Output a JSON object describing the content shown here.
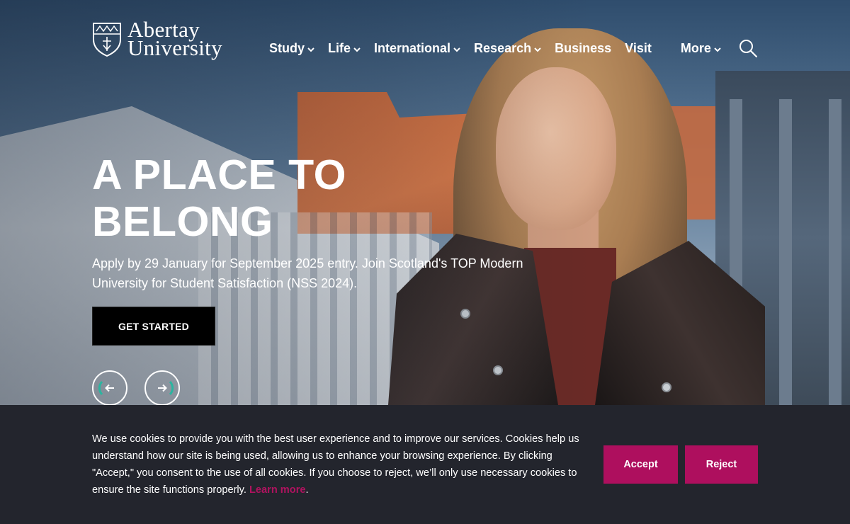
{
  "header": {
    "logo": {
      "line1": "Abertay",
      "line2": "University"
    },
    "nav": [
      {
        "label": "Study",
        "has_dropdown": true
      },
      {
        "label": "Life",
        "has_dropdown": true
      },
      {
        "label": "International",
        "has_dropdown": true
      },
      {
        "label": "Research",
        "has_dropdown": true
      },
      {
        "label": "Business",
        "has_dropdown": false
      },
      {
        "label": "Visit",
        "has_dropdown": false
      },
      {
        "label": "More",
        "has_dropdown": true
      }
    ],
    "search_icon": "search-icon"
  },
  "hero": {
    "title_line1": "A PLACE TO",
    "title_line2": "BELONG",
    "subtitle": "Apply by 29 January for September 2025 entry. Join Scotland's TOP Modern University for Student Satisfaction (NSS 2024).",
    "cta_label": "GET STARTED",
    "prev_icon": "arrow-left-icon",
    "next_icon": "arrow-right-icon"
  },
  "cookie": {
    "text": "We use cookies to provide you with the best user experience and to improve our services. Cookies help us understand how our site is being used, allowing us to enhance your browsing experience. By clicking \"Accept,\" you consent to the use of all cookies. If you choose to reject, we’ll only use necessary cookies to ensure the site functions properly.",
    "learn_more": "Learn more",
    "trailing": ".",
    "accept_label": "Accept",
    "reject_label": "Reject"
  },
  "colors": {
    "accent": "#ae0f5e",
    "banner_bg": "#23252d",
    "carousel_ring": "#2bb5a0"
  }
}
